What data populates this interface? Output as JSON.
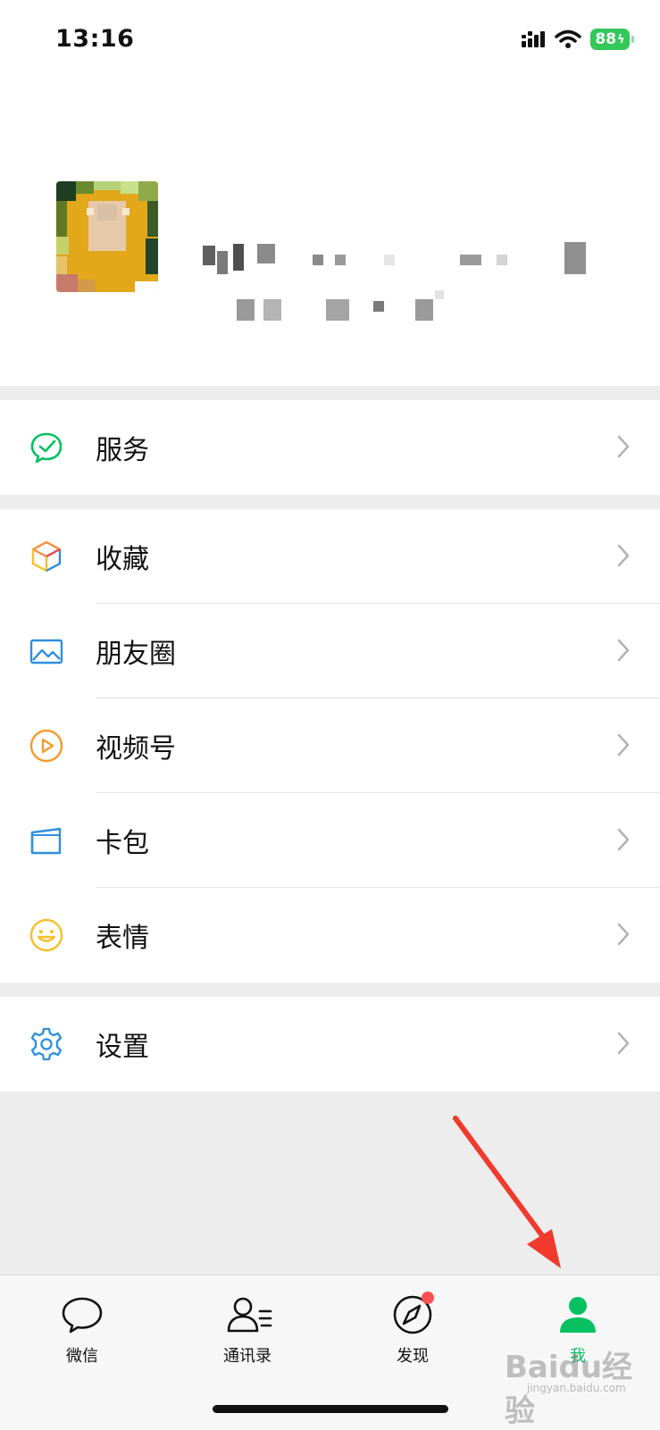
{
  "status_bar": {
    "time": "13:16",
    "battery": "88"
  },
  "menu": {
    "services": "服务",
    "favorites": "收藏",
    "moments": "朋友圈",
    "channels": "视频号",
    "cards": "卡包",
    "stickers": "表情",
    "settings": "设置"
  },
  "tabbar": {
    "chats": "微信",
    "contacts": "通讯录",
    "discover": "发现",
    "me": "我"
  },
  "watermark": {
    "text": "Baidu经验",
    "sub": "jingyan.baidu.com"
  },
  "colors": {
    "accent": "#07c160",
    "badge": "#fa5151",
    "arrow": "#f03a2e"
  }
}
